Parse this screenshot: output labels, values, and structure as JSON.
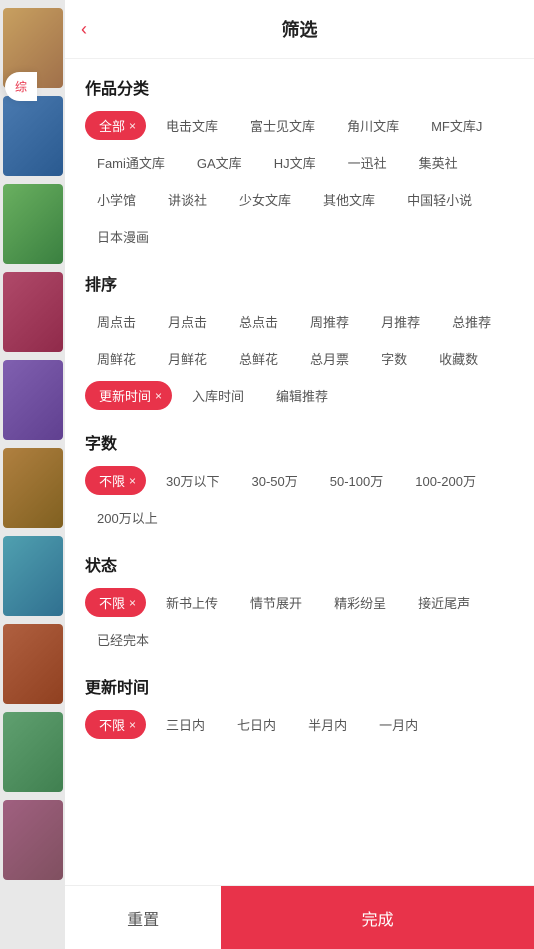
{
  "header": {
    "title": "筛选",
    "back_label": "‹"
  },
  "sections": [
    {
      "id": "category",
      "title": "作品分类",
      "tags": [
        {
          "label": "全部",
          "active": true
        },
        {
          "label": "电击文库",
          "active": false
        },
        {
          "label": "富士见文库",
          "active": false
        },
        {
          "label": "角川文库",
          "active": false
        },
        {
          "label": "MF文库J",
          "active": false
        },
        {
          "label": "Fami通文库",
          "active": false
        },
        {
          "label": "GA文库",
          "active": false
        },
        {
          "label": "HJ文库",
          "active": false
        },
        {
          "label": "一迅社",
          "active": false
        },
        {
          "label": "集英社",
          "active": false
        },
        {
          "label": "小学馆",
          "active": false
        },
        {
          "label": "讲谈社",
          "active": false
        },
        {
          "label": "少女文库",
          "active": false
        },
        {
          "label": "其他文库",
          "active": false
        },
        {
          "label": "中国轻小说",
          "active": false
        },
        {
          "label": "日本漫画",
          "active": false
        }
      ]
    },
    {
      "id": "sort",
      "title": "排序",
      "tags": [
        {
          "label": "周点击",
          "active": false
        },
        {
          "label": "月点击",
          "active": false
        },
        {
          "label": "总点击",
          "active": false
        },
        {
          "label": "周推荐",
          "active": false
        },
        {
          "label": "月推荐",
          "active": false
        },
        {
          "label": "总推荐",
          "active": false
        },
        {
          "label": "周鲜花",
          "active": false
        },
        {
          "label": "月鲜花",
          "active": false
        },
        {
          "label": "总鲜花",
          "active": false
        },
        {
          "label": "总月票",
          "active": false
        },
        {
          "label": "字数",
          "active": false
        },
        {
          "label": "收藏数",
          "active": false
        },
        {
          "label": "更新时间",
          "active": true
        },
        {
          "label": "入库时间",
          "active": false
        },
        {
          "label": "编辑推荐",
          "active": false
        }
      ]
    },
    {
      "id": "wordcount",
      "title": "字数",
      "tags": [
        {
          "label": "不限",
          "active": true
        },
        {
          "label": "30万以下",
          "active": false
        },
        {
          "label": "30-50万",
          "active": false
        },
        {
          "label": "50-100万",
          "active": false
        },
        {
          "label": "100-200万",
          "active": false
        },
        {
          "label": "200万以上",
          "active": false
        }
      ]
    },
    {
      "id": "status",
      "title": "状态",
      "tags": [
        {
          "label": "不限",
          "active": true
        },
        {
          "label": "新书上传",
          "active": false
        },
        {
          "label": "情节展开",
          "active": false
        },
        {
          "label": "精彩纷呈",
          "active": false
        },
        {
          "label": "接近尾声",
          "active": false
        },
        {
          "label": "已经完本",
          "active": false
        }
      ]
    },
    {
      "id": "update_time",
      "title": "更新时间",
      "tags": [
        {
          "label": "不限",
          "active": true
        },
        {
          "label": "三日内",
          "active": false
        },
        {
          "label": "七日内",
          "active": false
        },
        {
          "label": "半月内",
          "active": false
        },
        {
          "label": "一月内",
          "active": false
        }
      ]
    }
  ],
  "bottom": {
    "reset_label": "重置",
    "confirm_label": "完成"
  },
  "sidebar_tab": "综"
}
